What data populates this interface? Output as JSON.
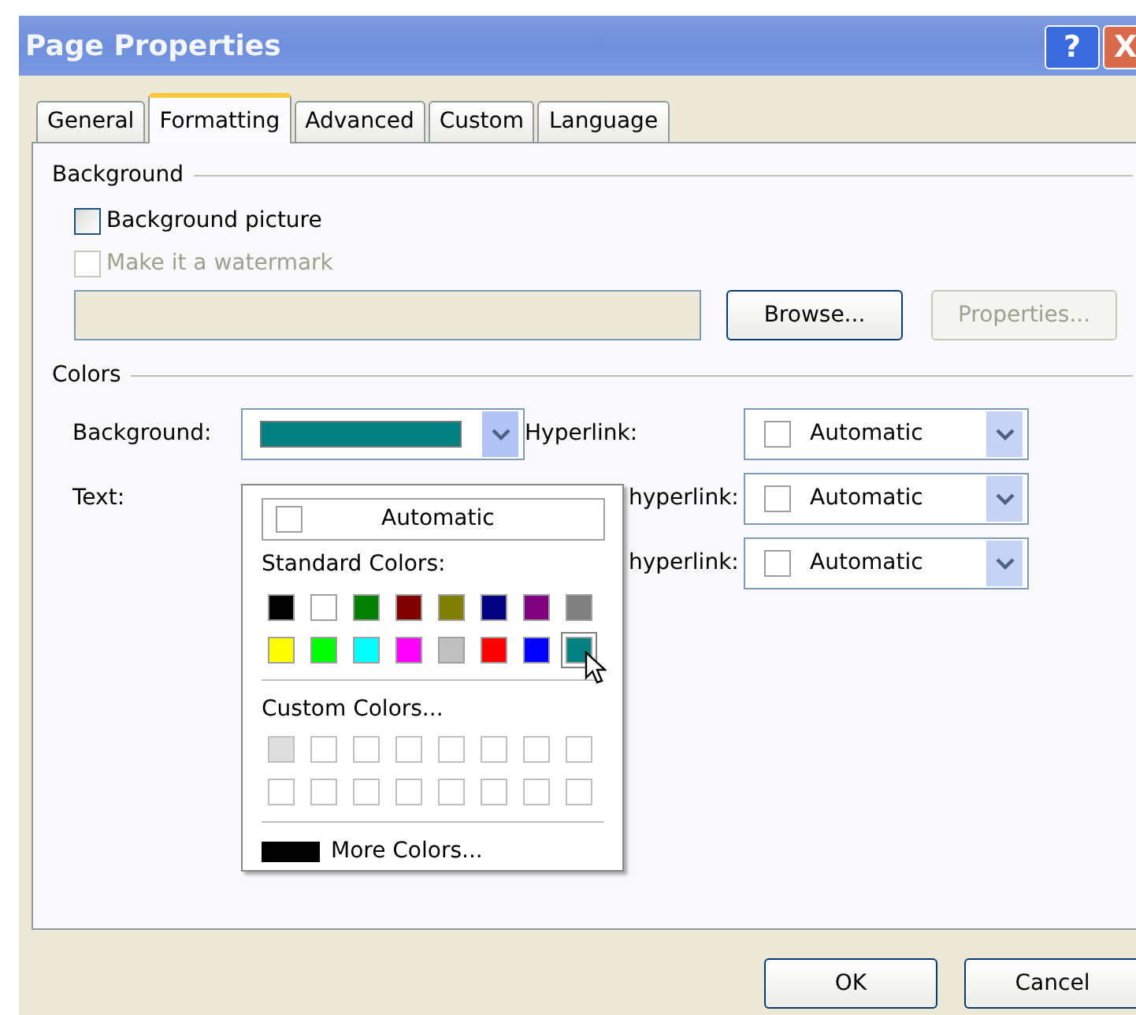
{
  "window": {
    "title": "Page Properties",
    "title_buttons": [
      "?",
      "X"
    ]
  },
  "tabs": [
    {
      "label": "General",
      "selected": false
    },
    {
      "label": "Formatting",
      "selected": true
    },
    {
      "label": "Advanced",
      "selected": false
    },
    {
      "label": "Custom",
      "selected": false
    },
    {
      "label": "Language",
      "selected": false
    }
  ],
  "background_group": {
    "title": "Background",
    "checkboxes": [
      {
        "label": "Background picture",
        "checked": false,
        "disabled": false
      },
      {
        "label": "Make it a watermark",
        "checked": false,
        "disabled": true
      }
    ],
    "picture_path": {
      "disabled": true
    },
    "buttons": [
      {
        "label": "Browse...",
        "disabled": false
      },
      {
        "label": "Properties...",
        "disabled": true
      }
    ]
  },
  "colors_group": {
    "title": "Colors",
    "rows": [
      {
        "left": {
          "label": "Background:",
          "dropdown": {
            "color": "#008080",
            "expanded": true
          }
        },
        "right": {
          "label": "Hyperlink:",
          "dropdown": {
            "value": "Automatic",
            "expanded": false
          }
        }
      },
      {
        "left": {
          "label": "Text:"
        },
        "right": {
          "label": "hyperlink:",
          "dropdown": {
            "value": "Automatic",
            "expanded": false
          }
        }
      },
      {
        "right": {
          "label": "hyperlink:",
          "dropdown": {
            "value": "Automatic",
            "expanded": false
          }
        }
      }
    ]
  },
  "color_popup": {
    "automatic": "Automatic",
    "standard_title": "Standard Colors:",
    "standard_colors": [
      {
        "color": "#000000",
        "selected": false
      },
      {
        "color": "#ffffff",
        "selected": false
      },
      {
        "color": "#008000",
        "selected": false
      },
      {
        "color": "#800000",
        "selected": false
      },
      {
        "color": "#808000",
        "selected": false
      },
      {
        "color": "#000080",
        "selected": false
      },
      {
        "color": "#800080",
        "selected": false
      },
      {
        "color": "#808080",
        "selected": false
      },
      {
        "color": "#ffff00",
        "selected": false
      },
      {
        "color": "#00ff00",
        "selected": false
      },
      {
        "color": "#00ffff",
        "selected": false
      },
      {
        "color": "#ff00ff",
        "selected": false
      },
      {
        "color": "#c0c0c0",
        "selected": false
      },
      {
        "color": "#ff0000",
        "selected": false
      },
      {
        "color": "#0000ff",
        "selected": false
      },
      {
        "color": "#008080",
        "selected": true
      }
    ],
    "custom_title": "Custom Colors...",
    "custom_colors": [
      {
        "color": "#dedede"
      },
      {
        "color": "#ffffff"
      },
      {
        "color": "#ffffff"
      },
      {
        "color": "#ffffff"
      },
      {
        "color": "#ffffff"
      },
      {
        "color": "#ffffff"
      },
      {
        "color": "#ffffff"
      },
      {
        "color": "#ffffff"
      },
      {
        "color": "#ffffff"
      },
      {
        "color": "#ffffff"
      },
      {
        "color": "#ffffff"
      },
      {
        "color": "#ffffff"
      },
      {
        "color": "#ffffff"
      },
      {
        "color": "#ffffff"
      },
      {
        "color": "#ffffff"
      },
      {
        "color": "#ffffff"
      }
    ],
    "more_colors": {
      "label": "More Colors...",
      "color": "#000000"
    }
  },
  "footer_buttons": [
    "OK",
    "Cancel"
  ]
}
